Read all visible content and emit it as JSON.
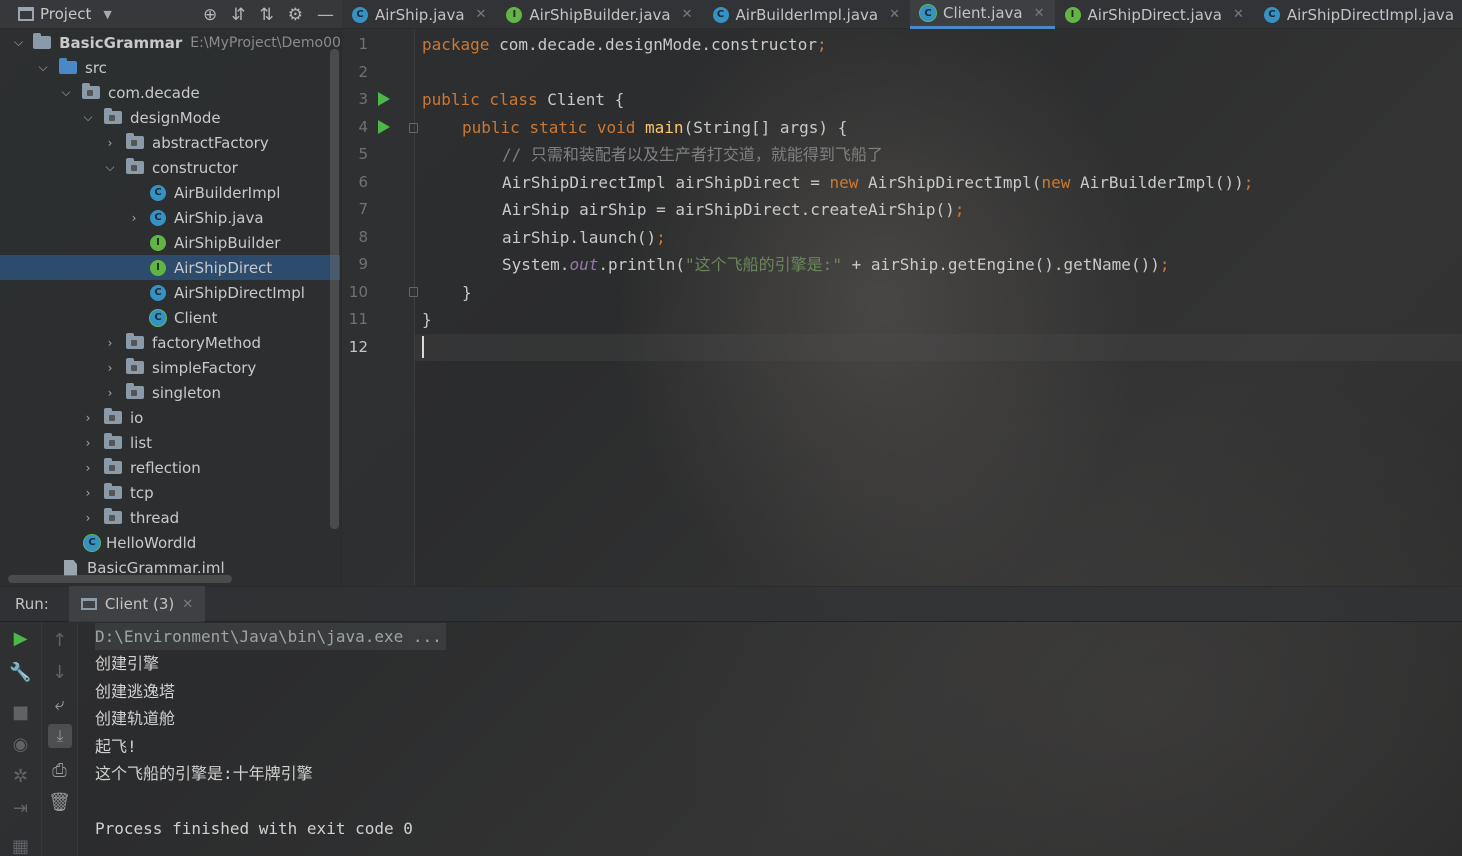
{
  "project_toolbar": {
    "title": "Project"
  },
  "tabs": [
    {
      "label": "AirShip.java",
      "kind": "class"
    },
    {
      "label": "AirShipBuilder.java",
      "kind": "interface"
    },
    {
      "label": "AirBuilderImpl.java",
      "kind": "class"
    },
    {
      "label": "Client.java",
      "kind": "main",
      "active": true
    },
    {
      "label": "AirShipDirect.java",
      "kind": "interface"
    },
    {
      "label": "AirShipDirectImpl.java",
      "kind": "class"
    }
  ],
  "tree": {
    "root_label": "BasicGrammar",
    "root_path": "E:\\MyProject\\Demo00",
    "items": [
      "src",
      "com.decade",
      "designMode",
      "abstractFactory",
      "constructor",
      "AirBuilderImpl",
      "AirShip.java",
      "AirShipBuilder",
      "AirShipDirect",
      "AirShipDirectImpl",
      "Client",
      "factoryMethod",
      "simpleFactory",
      "singleton",
      "io",
      "list",
      "reflection",
      "tcp",
      "thread",
      "HelloWordld",
      "BasicGrammar.iml"
    ]
  },
  "editor": {
    "line_numbers": [
      "1",
      "2",
      "3",
      "4",
      "5",
      "6",
      "7",
      "8",
      "9",
      "10",
      "11",
      "12"
    ],
    "code": {
      "l1_kw": "package",
      "l1_rest": " com.decade.designMode.constructor",
      "l1_semi": ";",
      "l3_kw": "public class",
      "l3_rest": " Client {",
      "l4_kw": "public static void",
      "l4_fn": "main",
      "l4_rest": "(String[] args) {",
      "l5_comment": "// 只需和装配者以及生产者打交道，就能得到飞船了",
      "l6_a": "AirShipDirectImpl airShipDirect = ",
      "l6_new1": "new",
      "l6_b": " AirShipDirectImpl(",
      "l6_new2": "new",
      "l6_c": " AirBuilderImpl())",
      "l6_semi": ";",
      "l7_a": "AirShip airShip = airShipDirect.createAirShip()",
      "l7_semi": ";",
      "l8_a": "airShip.launch()",
      "l8_semi": ";",
      "l9_a": "System.",
      "l9_out": "out",
      "l9_b": ".println(",
      "l9_str": "\"这个飞船的引擎是:\"",
      "l9_c": " + airShip.getEngine().getName())",
      "l9_semi": ";",
      "l10": "}",
      "l11": "}"
    }
  },
  "run_panel": {
    "label": "Run:",
    "tab_label": "Client (3)",
    "console": {
      "command": "D:\\Environment\\Java\\bin\\java.exe ...",
      "lines": [
        "创建引擎",
        "创建逃逸塔",
        "创建轨道舱",
        "起飞!",
        "这个飞船的引擎是:十年牌引擎"
      ],
      "exit": "Process finished with exit code 0"
    }
  },
  "colors": {
    "keyword": "#cc7832",
    "function": "#ffc66d",
    "comment": "#808080",
    "string": "#6a8759",
    "static_field": "#9876aa",
    "selection": "#2d4b6d",
    "active_tab_underline": "#4a88c7",
    "run_green": "#4cb848"
  },
  "icons": [
    "project-window-icon",
    "dropdown-icon",
    "locate-icon",
    "expand-all-icon",
    "collapse-all-icon",
    "settings-icon",
    "minimize-icon",
    "run-icon",
    "wrench-icon",
    "stop-icon",
    "camera-icon",
    "gear-small-icon",
    "exit-icon",
    "scroll-up-icon",
    "scroll-down-icon",
    "soft-wrap-icon",
    "scroll-to-end-icon",
    "print-icon",
    "trash-icon"
  ]
}
